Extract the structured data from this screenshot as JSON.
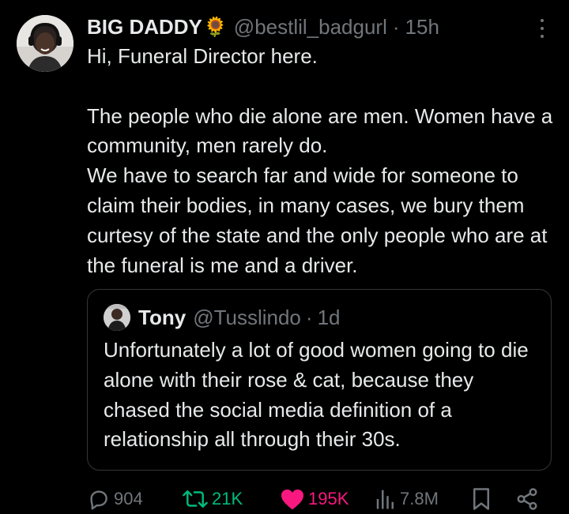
{
  "tweet": {
    "display_name": "BIG DADDY",
    "name_emoji": "🌻",
    "handle": "@bestlil_badgurl",
    "separator": "·",
    "time": "15h",
    "text": "Hi, Funeral Director here.\n\nThe people who die alone are men. Women have a community, men rarely do.\nWe have to search far and wide for someone to claim their bodies, in many cases, we bury them curtesy of the state and the only people who are at the funeral is me and a driver."
  },
  "quote": {
    "display_name": "Tony",
    "handle": "@Tusslindo",
    "separator": "·",
    "time": "1d",
    "text": "Unfortunately a lot of good women going to die alone with their rose & cat, because they chased the social media definition of a relationship all through their 30s."
  },
  "actions": {
    "replies": "904",
    "retweets": "21K",
    "likes": "195K",
    "views": "7.8M"
  },
  "colors": {
    "background": "#000000",
    "text": "#e7e9ea",
    "muted": "#71767b",
    "retweet_active": "#00ba7c",
    "like_active": "#f91880",
    "border": "#333639"
  },
  "icons": [
    "more-icon",
    "reply-icon",
    "retweet-icon",
    "like-icon",
    "views-icon",
    "bookmark-icon",
    "share-icon"
  ]
}
